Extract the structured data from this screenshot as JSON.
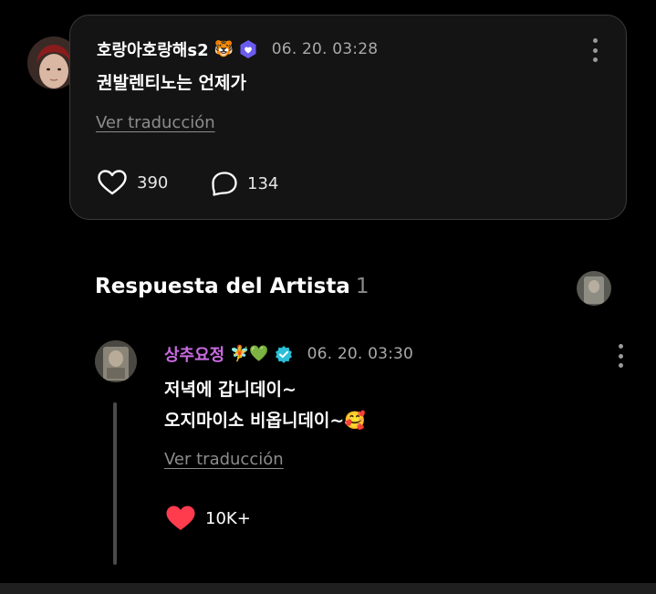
{
  "post": {
    "username": "호랑아호랑해s2",
    "username_emoji": "🐯",
    "timestamp": "06. 20. 03:28",
    "text": "권발렌티노는 언제가",
    "translate_label": "Ver traducción",
    "likes": "390",
    "comments": "134"
  },
  "artist_section": {
    "title": "Respuesta del Artista",
    "count": "1"
  },
  "reply": {
    "username": "상추요정",
    "username_emoji": "🧚💚",
    "timestamp": "06. 20. 03:30",
    "text_line1": "저녁에 갑니데이~",
    "text_line2": "오지마이소 비옵니데이~🥰",
    "translate_label": "Ver traducción",
    "likes": "10K+"
  },
  "colors": {
    "background": "#000000",
    "card": "#141414",
    "like_active": "#ff3b4e",
    "reply_username": "#c86be0",
    "verified_badge": "#2bbfd8",
    "fan_badge": "#6b5cf0"
  },
  "icons": [
    "user-avatar",
    "fan-badge-icon",
    "more-options-icon",
    "heart-outline-icon",
    "comment-bubble-icon",
    "artist-avatar",
    "verified-badge-icon",
    "heart-filled-icon"
  ]
}
